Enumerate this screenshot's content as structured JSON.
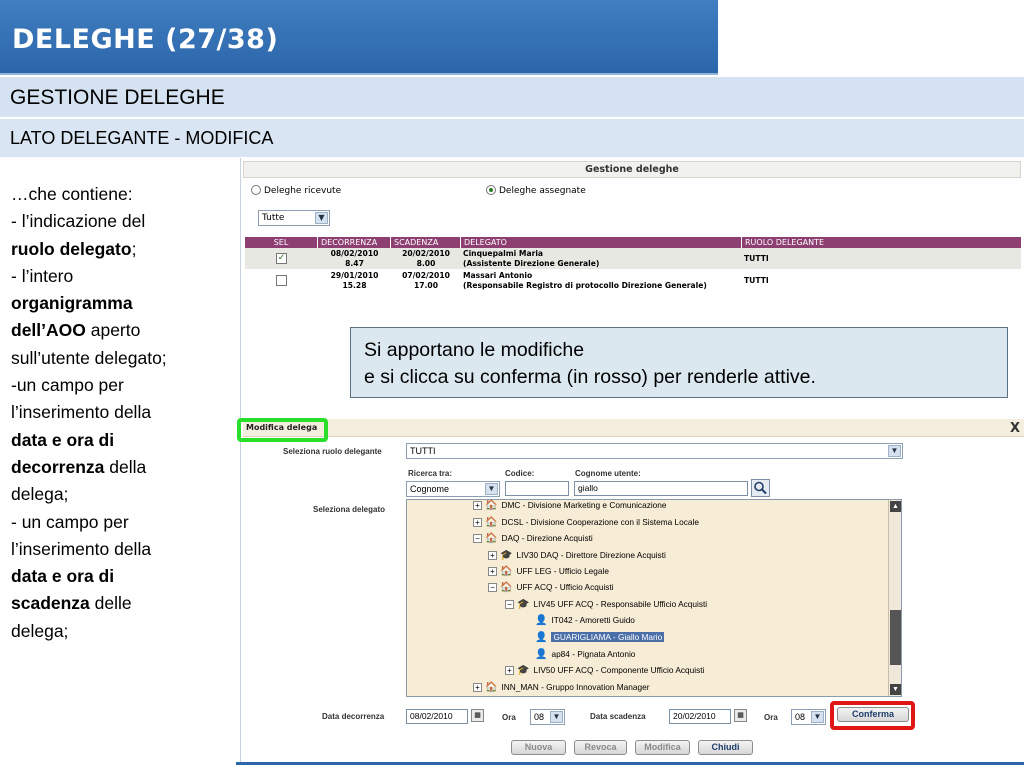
{
  "slide": {
    "title": "DELEGHE (27/38)",
    "subtitle": "GESTIONE DELEGHE",
    "section": "LATO DELEGANTE - MODIFICA"
  },
  "left_text": {
    "l1": "…che contiene:",
    "l2": "- l’indicazione del",
    "l3_bold": "ruolo delegato",
    "l3_tail": ";",
    "l4": "- l’intero",
    "l5_bold": "organigramma",
    "l6_bold": "dell’AOO",
    "l6_tail": " aperto",
    "l7": "sull’utente delegato;",
    "l8": "-un campo per",
    "l9": "l’inserimento della",
    "l10_bold": "data e ora di",
    "l11_bold": "decorrenza",
    "l11_tail": " della",
    "l12": "delega;",
    "l13": "- un campo per",
    "l14": "l’inserimento della",
    "l15_bold": "data e ora di",
    "l16_bold": "scadenza",
    "l16_tail": " delle",
    "l17": "delega;"
  },
  "callout": {
    "line1": "Si apportano le modifiche",
    "line2": "e si clicca su conferma (in rosso) per renderle attive."
  },
  "app": {
    "title": "Gestione deleghe",
    "radio_received": "Deleghe ricevute",
    "radio_assigned": "Deleghe assegnate",
    "filter_value": "Tutte",
    "grid": {
      "headers": [
        "SEL",
        "DECORRENZA",
        "SCADENZA",
        "DELEGATO",
        "RUOLO DELEGANTE"
      ],
      "rows": [
        {
          "checked": "✓",
          "dec_date": "08/02/2010",
          "dec_time": "8.47",
          "sca_date": "20/02/2010",
          "sca_time": "8.00",
          "name": "Cinquepalmi Maria",
          "role_desc": "(Assistente Direzione Generale)",
          "ruolo": "TUTTI"
        },
        {
          "checked": "",
          "dec_date": "29/01/2010",
          "dec_time": "15.28",
          "sca_date": "07/02/2010",
          "sca_time": "17.00",
          "name": "Massari Antonio",
          "role_desc": "(Responsabile Registro di protocollo Direzione Generale)",
          "ruolo": "TUTTI"
        }
      ]
    },
    "modifica": {
      "title": "Modifica delega",
      "close": "X",
      "role_label": "Seleziona ruolo delegante",
      "role_value": "TUTTI",
      "search_label": "Ricerca tra:",
      "code_label": "Codice:",
      "surname_label": "Cognome utente:",
      "search_value": "Cognome",
      "code_value": "",
      "surname_value": "giallo",
      "delegate_label": "Seleziona delegato",
      "tree": [
        "DMC - Divisione Marketing e Comunicazione",
        "DCSL - Divisione Cooperazione con il Sistema Locale",
        "DAQ - Direzione Acquisti",
        "LIV30 DAQ - Direttore Direzione Acquisti",
        "UFF LEG - Ufficio Legale",
        "UFF ACQ - Ufficio Acquisti",
        "LIV45 UFF ACQ - Responsabile Ufficio Acquisti",
        "IT042 - Amoretti Guido",
        "GUARIGLIAMA - Giallo Mario",
        "ap84 - Pignata Antonio",
        "LIV50 UFF ACQ - Componente Ufficio Acquisti",
        "INN_MAN - Gruppo Innovation Manager"
      ],
      "start_label": "Data decorrenza",
      "start_date": "08/02/2010",
      "start_hour_label": "Ora",
      "start_hour": "08",
      "end_label": "Data scadenza",
      "end_date": "20/02/2010",
      "end_hour_label": "Ora",
      "end_hour": "08",
      "confirm": "Conferma"
    },
    "buttons": {
      "new": "Nuova",
      "revoke": "Revoca",
      "edit": "Modifica",
      "close": "Chiudi"
    }
  },
  "colors": {
    "title_bg": "#2c66aa",
    "grid_header": "#8d3f72",
    "tree_bg": "#f7ecd6",
    "highlight_green": "#2adf2a",
    "highlight_red": "#e11717"
  }
}
